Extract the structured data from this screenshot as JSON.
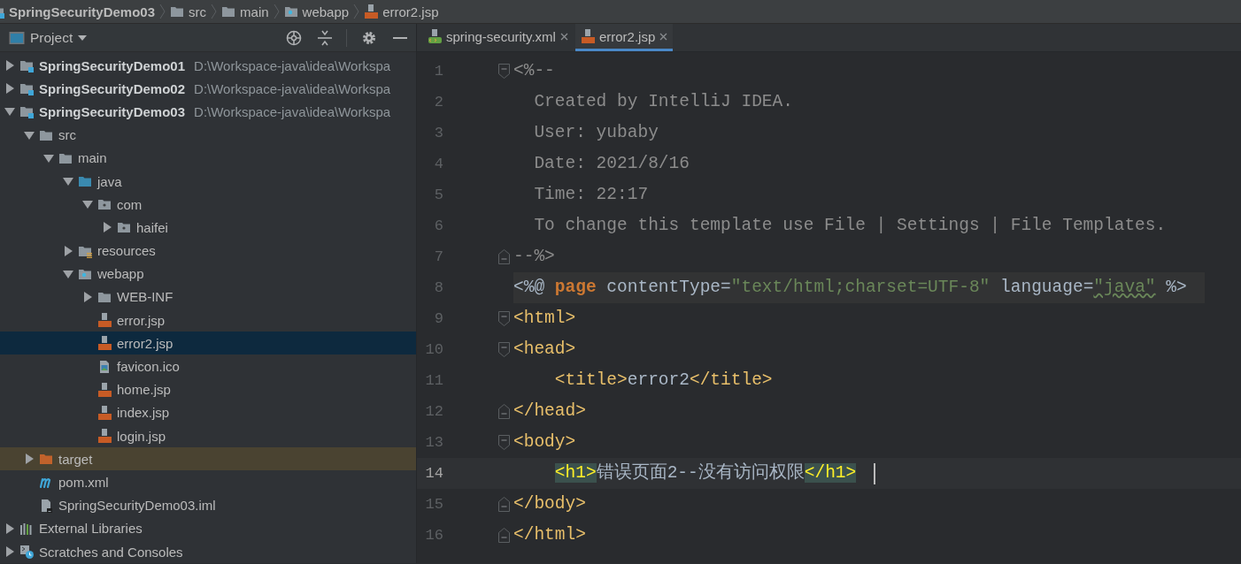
{
  "breadcrumbs": [
    {
      "label": "SpringSecurityDemo03",
      "kind": "module"
    },
    {
      "label": "src",
      "kind": "folder"
    },
    {
      "label": "main",
      "kind": "folder"
    },
    {
      "label": "webapp",
      "kind": "web"
    },
    {
      "label": "error2.jsp",
      "kind": "jsp"
    }
  ],
  "project_panel": {
    "title": "Project",
    "tree": [
      {
        "label": "SpringSecurityDemo01",
        "path": "D:\\Workspace-java\\idea\\Workspa",
        "kind": "module",
        "expanded": false,
        "selected": false,
        "highlighted": false
      },
      {
        "label": "SpringSecurityDemo02",
        "path": "D:\\Workspace-java\\idea\\Workspa",
        "kind": "module",
        "expanded": false,
        "selected": false,
        "highlighted": false
      },
      {
        "label": "SpringSecurityDemo03",
        "path": "D:\\Workspace-java\\idea\\Workspa",
        "kind": "module",
        "expanded": true,
        "selected": false,
        "highlighted": false,
        "children": [
          {
            "label": "src",
            "kind": "folder",
            "expanded": true,
            "selected": false,
            "highlighted": false,
            "children": [
              {
                "label": "main",
                "kind": "folder",
                "expanded": true,
                "selected": false,
                "highlighted": false,
                "children": [
                  {
                    "label": "java",
                    "kind": "source",
                    "expanded": true,
                    "selected": false,
                    "highlighted": false,
                    "children": [
                      {
                        "label": "com",
                        "kind": "package",
                        "expanded": true,
                        "selected": false,
                        "highlighted": false,
                        "children": [
                          {
                            "label": "haifei",
                            "kind": "package",
                            "expanded": false,
                            "selected": false,
                            "highlighted": false
                          }
                        ]
                      }
                    ]
                  },
                  {
                    "label": "resources",
                    "kind": "resources",
                    "expanded": false,
                    "selected": false,
                    "highlighted": false
                  },
                  {
                    "label": "webapp",
                    "kind": "web",
                    "expanded": true,
                    "selected": false,
                    "highlighted": false,
                    "children": [
                      {
                        "label": "WEB-INF",
                        "kind": "folder",
                        "expanded": false,
                        "selected": false,
                        "highlighted": false
                      },
                      {
                        "label": "error.jsp",
                        "kind": "jsp",
                        "selected": false,
                        "highlighted": false
                      },
                      {
                        "label": "error2.jsp",
                        "kind": "jsp",
                        "selected": true,
                        "highlighted": false
                      },
                      {
                        "label": "favicon.ico",
                        "kind": "image",
                        "selected": false,
                        "highlighted": false
                      },
                      {
                        "label": "home.jsp",
                        "kind": "jsp",
                        "selected": false,
                        "highlighted": false
                      },
                      {
                        "label": "index.jsp",
                        "kind": "jsp",
                        "selected": false,
                        "highlighted": false
                      },
                      {
                        "label": "login.jsp",
                        "kind": "jsp",
                        "selected": false,
                        "highlighted": false
                      }
                    ]
                  }
                ]
              }
            ]
          },
          {
            "label": "target",
            "kind": "excluded",
            "expanded": false,
            "selected": false,
            "highlighted": true
          },
          {
            "label": "pom.xml",
            "kind": "maven",
            "selected": false,
            "highlighted": false
          },
          {
            "label": "SpringSecurityDemo03.iml",
            "kind": "iml",
            "selected": false,
            "highlighted": false
          }
        ]
      },
      {
        "label": "External Libraries",
        "kind": "libraries",
        "expanded": false,
        "selected": false,
        "highlighted": false
      },
      {
        "label": "Scratches and Consoles",
        "kind": "scratches",
        "expanded": false,
        "selected": false,
        "highlighted": false
      }
    ]
  },
  "editor": {
    "tabs": [
      {
        "label": "spring-security.xml",
        "kind": "xml",
        "selected": false
      },
      {
        "label": "error2.jsp",
        "kind": "jsp",
        "selected": true
      }
    ],
    "lines": [
      {
        "number": "1",
        "kind": "comment",
        "fold_start": true,
        "current": false,
        "tokens": [
          {
            "kind": "comment",
            "text": "<%--"
          }
        ]
      },
      {
        "number": "2",
        "kind": "comment",
        "current": false,
        "tokens": [
          {
            "kind": "comment",
            "text": "  Created by IntelliJ IDEA."
          }
        ]
      },
      {
        "number": "3",
        "kind": "comment",
        "current": false,
        "tokens": [
          {
            "kind": "comment",
            "text": "  User: yubaby"
          }
        ]
      },
      {
        "number": "4",
        "kind": "comment",
        "current": false,
        "tokens": [
          {
            "kind": "comment",
            "text": "  Date: 2021/8/16"
          }
        ]
      },
      {
        "number": "5",
        "kind": "comment",
        "current": false,
        "tokens": [
          {
            "kind": "comment",
            "text": "  Time: 22:17"
          }
        ]
      },
      {
        "number": "6",
        "kind": "comment",
        "current": false,
        "tokens": [
          {
            "kind": "comment",
            "text": "  To change this template use File | Settings | File Templates."
          }
        ]
      },
      {
        "number": "7",
        "kind": "comment",
        "fold_end": true,
        "current": false,
        "tokens": [
          {
            "kind": "comment",
            "text": "--%>"
          }
        ]
      },
      {
        "number": "8",
        "kind": "directive",
        "current": false,
        "tokens": [
          {
            "kind": "plain",
            "text": "<%@ "
          },
          {
            "kind": "keyword",
            "text": "page"
          },
          {
            "kind": "plain",
            "text": " contentType="
          },
          {
            "kind": "string",
            "text": "\"text/html;charset=UTF-8\""
          },
          {
            "kind": "plain",
            "text": " language="
          },
          {
            "kind": "typo-string",
            "text": "\"java\""
          },
          {
            "kind": "plain",
            "text": " %>"
          }
        ]
      },
      {
        "number": "9",
        "kind": "markup",
        "fold_start": true,
        "current": false,
        "tokens": [
          {
            "kind": "tag",
            "text": "<html>"
          }
        ]
      },
      {
        "number": "10",
        "kind": "markup",
        "fold_start": true,
        "current": false,
        "tokens": [
          {
            "kind": "tag",
            "text": "<head>"
          }
        ]
      },
      {
        "number": "11",
        "kind": "markup",
        "current": false,
        "tokens": [
          {
            "kind": "tag",
            "text": "    <title>"
          },
          {
            "kind": "plain",
            "text": "error2"
          },
          {
            "kind": "tag",
            "text": "</title>"
          }
        ]
      },
      {
        "number": "12",
        "kind": "markup",
        "fold_end": true,
        "current": false,
        "tokens": [
          {
            "kind": "tag",
            "text": "</head>"
          }
        ]
      },
      {
        "number": "13",
        "kind": "markup",
        "fold_start": true,
        "current": false,
        "tokens": [
          {
            "kind": "tag",
            "text": "<body>"
          }
        ]
      },
      {
        "number": "14",
        "kind": "markup",
        "current": true,
        "tokens": [
          {
            "kind": "matched-tag",
            "text": "    <h1>"
          },
          {
            "kind": "plain",
            "text": "错误页面2--没有访问权限"
          },
          {
            "kind": "matched-tag",
            "text": "</h1>"
          }
        ]
      },
      {
        "number": "15",
        "kind": "markup",
        "fold_end": true,
        "current": false,
        "tokens": [
          {
            "kind": "tag",
            "text": "</body>"
          }
        ]
      },
      {
        "number": "16",
        "kind": "markup",
        "fold_end": true,
        "current": false,
        "tokens": [
          {
            "kind": "tag",
            "text": "</html>"
          }
        ]
      }
    ]
  }
}
